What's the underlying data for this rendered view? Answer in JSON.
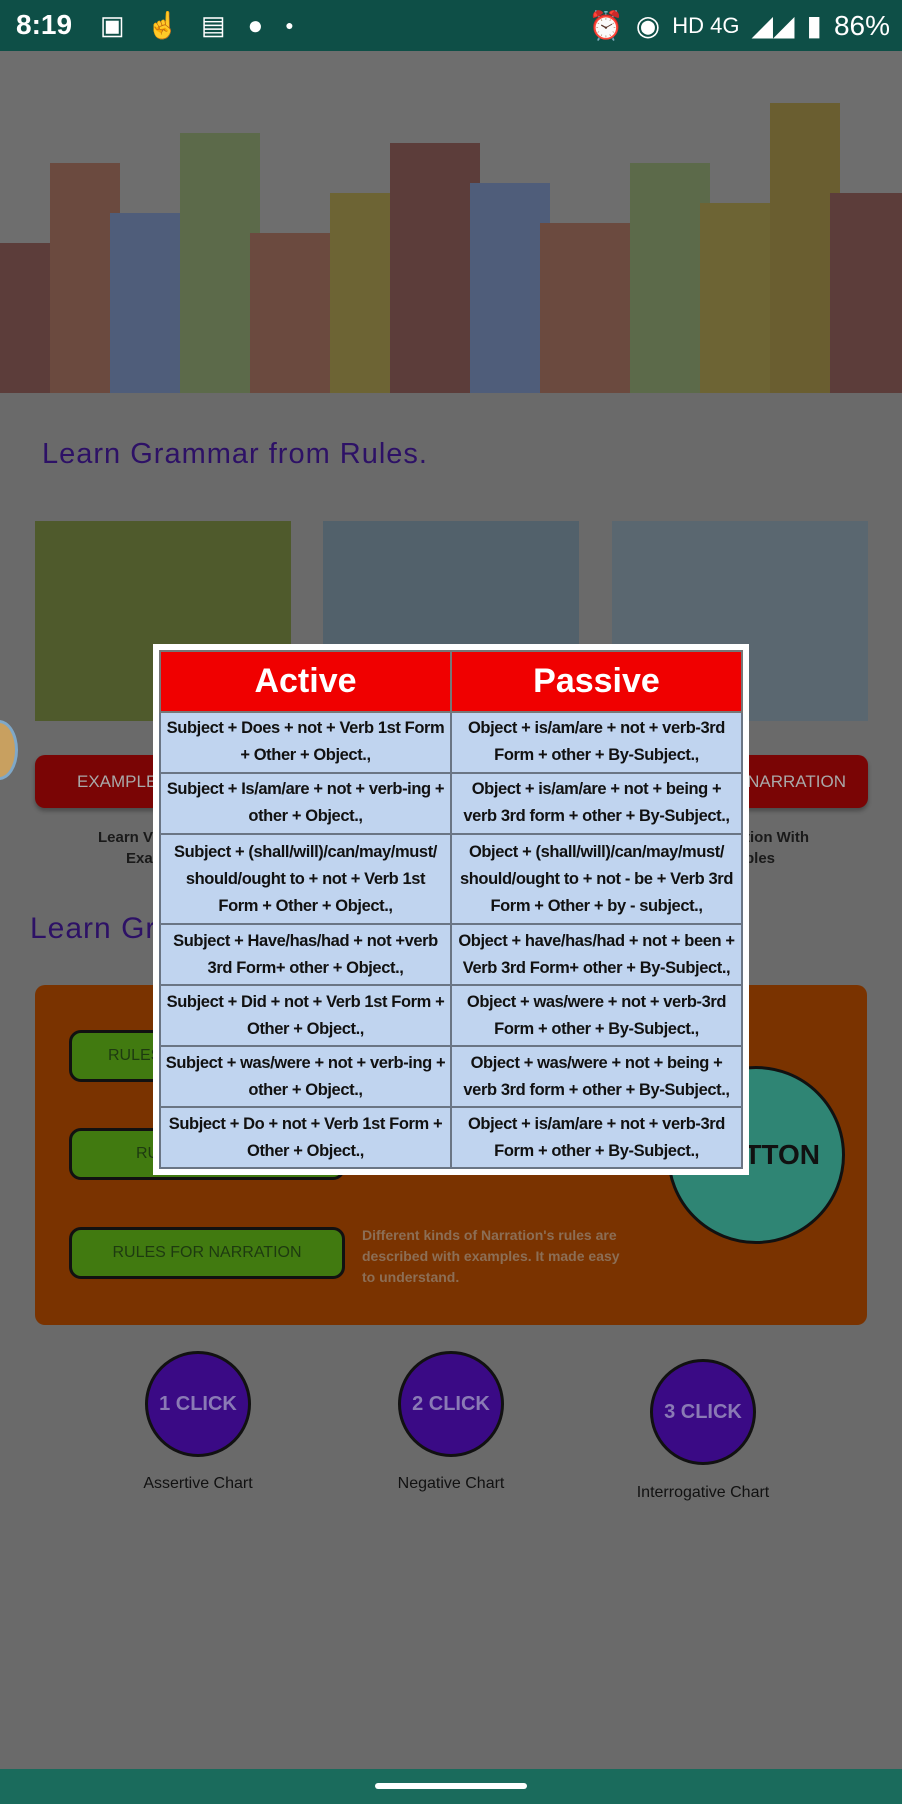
{
  "status_bar": {
    "time": "8:19",
    "network": "HD 4G",
    "battery": "86%",
    "icons": [
      "image-icon",
      "touch-icon",
      "document-icon",
      "circle-icon",
      "dot-icon",
      "alarm-icon",
      "hotspot-icon",
      "signal-icon",
      "signal-icon",
      "battery-icon"
    ]
  },
  "section1": {
    "title": "Learn Grammar from Rules.",
    "buttons": [
      {
        "label": "EXAMPLES"
      },
      {
        "label": ""
      },
      {
        "label": "FOR NARRATION"
      }
    ],
    "captions": [
      {
        "line1": "Learn V",
        "line2": "Exa"
      },
      {
        "line1": "tion With",
        "line2": "ples"
      }
    ]
  },
  "section2": {
    "title": "Learn Gr",
    "buttons": [
      {
        "label": "RULES"
      },
      {
        "label": "RU"
      },
      {
        "label": "RULES FOR NARRATION"
      }
    ],
    "narration_desc": "Different kinds of Narration's rules are described with examples. It made easy to understand.",
    "circle_button": "TTON"
  },
  "charts": [
    {
      "button": "1 CLICK",
      "label": "Assertive Chart"
    },
    {
      "button": "2 CLICK",
      "label": "Negative Chart"
    },
    {
      "button": "3 CLICK",
      "label": "Interrogative Chart"
    }
  ],
  "modal": {
    "headers": [
      "Active",
      "Passive"
    ],
    "rows": [
      [
        "Subject + Does + not + Verb 1st Form + Other + Object.,",
        "Object + is/am/are + not + verb-3rd Form + other + By-Subject.,"
      ],
      [
        "Subject + Is/am/are + not + verb-ing + other + Object.,",
        "Object + is/am/are + not + being + verb 3rd form + other + By-Subject.,"
      ],
      [
        "Subject + (shall/will)/can/may/must/ should/ought to + not + Verb 1st Form + Other + Object.,",
        "Object + (shall/will)/can/may/must/ should/ought to + not - be + Verb 3rd Form + Other + by - subject.,"
      ],
      [
        "Subject + Have/has/had + not +verb 3rd Form+ other + Object.,",
        "Object + have/has/had + not + been + Verb 3rd Form+ other + By-Subject.,"
      ],
      [
        "Subject + Did + not + Verb 1st Form + Other + Object.,",
        "Object + was/were + not + verb-3rd Form + other + By-Subject.,"
      ],
      [
        "Subject + was/were + not + verb-ing + other + Object.,",
        "Object + was/were + not + being + verb 3rd form + other + By-Subject.,"
      ],
      [
        "Subject  + Do + not + Verb 1st Form + Other + Object.,",
        "Object + is/am/are + not + verb-3rd Form + other + By-Subject.,"
      ]
    ],
    "colors": {
      "header": "#f00000",
      "cell": "#c0d4ef"
    }
  }
}
